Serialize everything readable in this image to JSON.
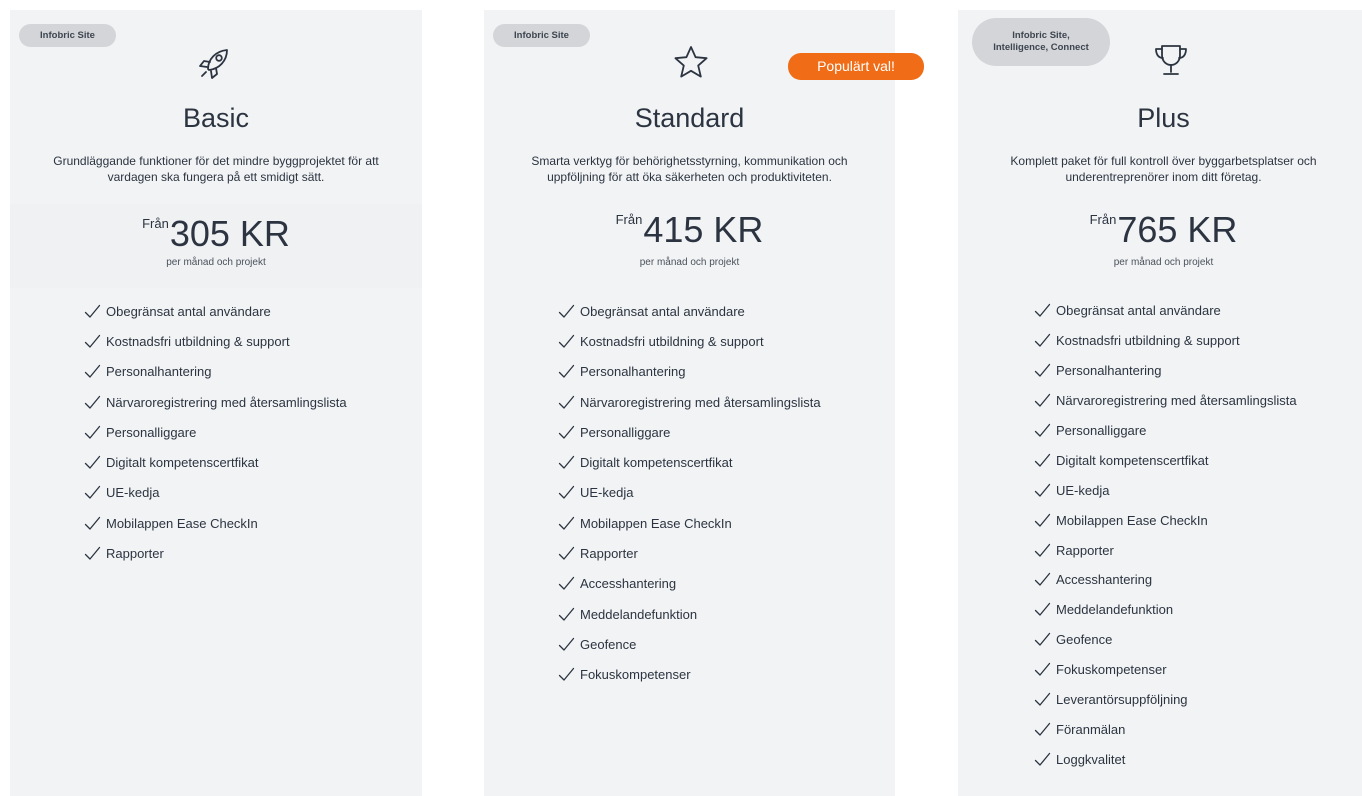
{
  "plans": [
    {
      "tag": "Infobric Site",
      "icon": "rocket-icon",
      "name": "Basic",
      "description": "Grundläggande funktioner för det mindre byggprojektet för att vardagen ska fungera på ett smidigt sätt.",
      "price_from": "Från",
      "price": "305 KR",
      "price_unit": "per månad och projekt",
      "features": [
        "Obegränsat antal användare",
        "Kostnadsfri utbildning & support",
        "Personalhantering",
        "Närvaroregistrering med återsamlingslista",
        "Personalliggare",
        "Digitalt kompetenscertfikat",
        "UE-kedja",
        "Mobilappen Ease CheckIn",
        "Rapporter"
      ]
    },
    {
      "tag": "Infobric Site",
      "icon": "star-icon",
      "badge": "Populärt val!",
      "name": "Standard",
      "description": "Smarta verktyg för behörighetsstyrning, kommunikation och uppföljning för att öka säkerheten och produktiviteten.",
      "price_from": "Från",
      "price": "415 KR",
      "price_unit": "per månad och projekt",
      "features": [
        "Obegränsat antal användare",
        "Kostnadsfri utbildning & support",
        "Personalhantering",
        "Närvaroregistrering med återsamlingslista",
        "Personalliggare",
        "Digitalt kompetenscertfikat",
        "UE-kedja",
        "Mobilappen Ease CheckIn",
        "Rapporter",
        "Accesshantering",
        "Meddelandefunktion",
        "Geofence",
        "Fokuskompetenser"
      ]
    },
    {
      "tag": "Infobric Site,\nIntelligence, Connect",
      "icon": "trophy-icon",
      "name": "Plus",
      "description": "Komplett paket för full kontroll över byggarbetsplatser och underentreprenörer inom ditt företag.",
      "price_from": "Från",
      "price": "765 KR",
      "price_unit": "per månad och projekt",
      "features": [
        "Obegränsat antal användare",
        "Kostnadsfri utbildning & support",
        "Personalhantering",
        "Närvaroregistrering med återsamlingslista",
        "Personalliggare",
        "Digitalt kompetenscertfikat",
        "UE-kedja",
        "Mobilappen Ease CheckIn",
        "Rapporter",
        "Accesshantering",
        "Meddelandefunktion",
        "Geofence",
        "Fokuskompetenser",
        "Leverantörsuppföljning",
        "Föranmälan",
        "Loggkvalitet"
      ]
    }
  ],
  "colors": {
    "card_bg": "#f2f3f5",
    "tag_bg": "#d4d5d8",
    "badge_bg": "#f06c16",
    "text": "#2b3440"
  }
}
